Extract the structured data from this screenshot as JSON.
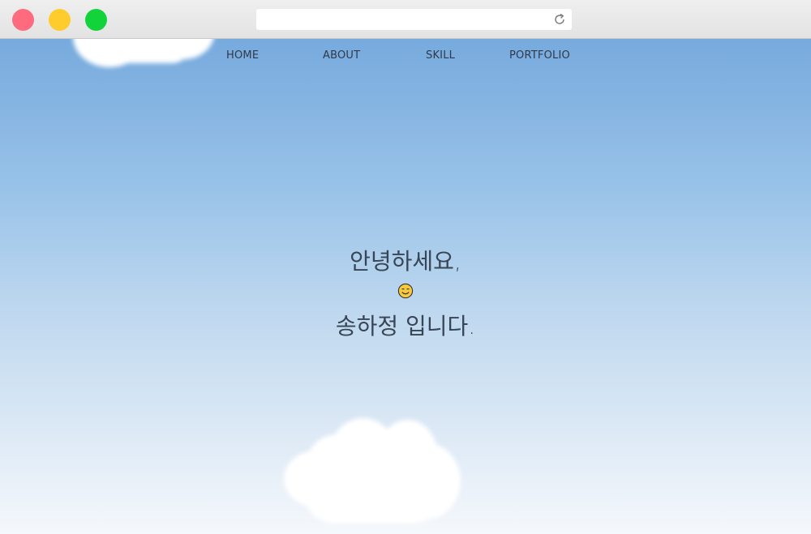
{
  "browser": {
    "url": "",
    "reload_icon": "reload-icon"
  },
  "nav": {
    "items": [
      {
        "label": "HOME"
      },
      {
        "label": "ABOUT"
      },
      {
        "label": "SKILL"
      },
      {
        "label": "PORTFOLIO"
      }
    ]
  },
  "hero": {
    "line1": "안녕하세요,",
    "emoji_icon": "smiling-face-icon",
    "line2": "송하정 입니다."
  },
  "colors": {
    "sky_top": "#77aadd",
    "sky_bottom": "#f5f8fc",
    "text": "#384554",
    "close": "#fe6a7e",
    "minimize": "#fecc2c",
    "maximize": "#12d33a"
  }
}
